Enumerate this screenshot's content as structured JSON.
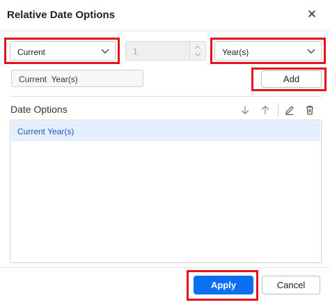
{
  "dialog": {
    "title": "Relative Date Options",
    "close_icon": "close-icon"
  },
  "controls": {
    "period_select": {
      "value": "Current",
      "icon": "chevron-down-icon"
    },
    "count_input": {
      "value": "1",
      "icon": "spinner-icon"
    },
    "unit_select": {
      "value": "Year(s)",
      "icon": "chevron-down-icon"
    },
    "preview_text": "Current  Year(s)",
    "add_label": "Add"
  },
  "date_options": {
    "label": "Date Options",
    "tools": [
      "arrow-down-icon",
      "arrow-up-icon",
      "pencil-icon",
      "trash-icon"
    ],
    "items": [
      "Current Year(s)"
    ],
    "selected_index": 0
  },
  "footer": {
    "apply_label": "Apply",
    "cancel_label": "Cancel"
  },
  "colors": {
    "highlight": "#e3121d",
    "primary": "#0b6ff2",
    "selected_bg": "#e4efff",
    "selected_text": "#1a56c8"
  }
}
